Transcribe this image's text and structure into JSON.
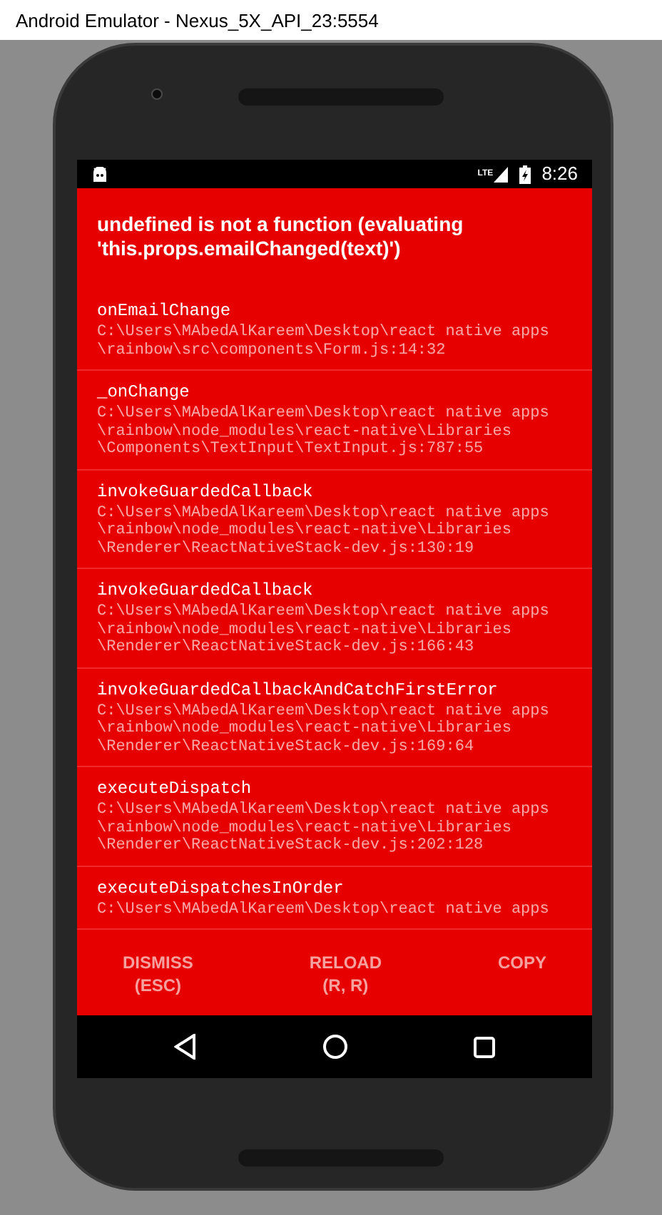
{
  "window": {
    "title": "Android Emulator - Nexus_5X_API_23:5554"
  },
  "status_bar": {
    "network": "LTE",
    "time": "8:26"
  },
  "error": {
    "message": "undefined is not a function (evaluating 'this.props.emailChanged(text)')",
    "frames": [
      {
        "method": "onEmailChange",
        "lines": [
          "C:\\Users\\MAbedAlKareem\\Desktop\\react native apps",
          "\\rainbow\\src\\components\\Form.js:14:32"
        ]
      },
      {
        "method": "_onChange",
        "lines": [
          "C:\\Users\\MAbedAlKareem\\Desktop\\react native apps",
          "\\rainbow\\node_modules\\react-native\\Libraries",
          "\\Components\\TextInput\\TextInput.js:787:55"
        ]
      },
      {
        "method": "invokeGuardedCallback",
        "lines": [
          "C:\\Users\\MAbedAlKareem\\Desktop\\react native apps",
          "\\rainbow\\node_modules\\react-native\\Libraries",
          "\\Renderer\\ReactNativeStack-dev.js:130:19"
        ]
      },
      {
        "method": "invokeGuardedCallback",
        "lines": [
          "C:\\Users\\MAbedAlKareem\\Desktop\\react native apps",
          "\\rainbow\\node_modules\\react-native\\Libraries",
          "\\Renderer\\ReactNativeStack-dev.js:166:43"
        ]
      },
      {
        "method": "invokeGuardedCallbackAndCatchFirstError",
        "lines": [
          "C:\\Users\\MAbedAlKareem\\Desktop\\react native apps",
          "\\rainbow\\node_modules\\react-native\\Libraries",
          "\\Renderer\\ReactNativeStack-dev.js:169:64"
        ]
      },
      {
        "method": "executeDispatch",
        "lines": [
          "C:\\Users\\MAbedAlKareem\\Desktop\\react native apps",
          "\\rainbow\\node_modules\\react-native\\Libraries",
          "\\Renderer\\ReactNativeStack-dev.js:202:128"
        ]
      },
      {
        "method": "executeDispatchesInOrder",
        "lines": [
          "C:\\Users\\MAbedAlKareem\\Desktop\\react native apps"
        ]
      }
    ]
  },
  "buttons": [
    {
      "label": "DISMISS",
      "hint": "(ESC)"
    },
    {
      "label": "RELOAD",
      "hint": "(R, R)"
    },
    {
      "label": "COPY"
    }
  ]
}
